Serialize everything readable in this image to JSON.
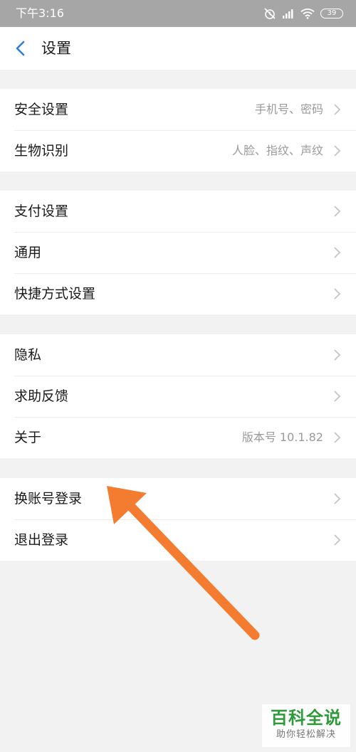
{
  "status_bar": {
    "time": "下午3:16",
    "battery": "39",
    "icons": [
      "alarm-off-icon",
      "signal-icon",
      "wifi-icon",
      "battery-icon"
    ]
  },
  "header": {
    "back_icon": "chevron-left-icon",
    "title": "设置",
    "accent_color": "#2b7fd9"
  },
  "groups": [
    {
      "items": [
        {
          "label": "安全设置",
          "value": "手机号、密码"
        },
        {
          "label": "生物识别",
          "value": "人脸、指纹、声纹"
        }
      ]
    },
    {
      "items": [
        {
          "label": "支付设置",
          "value": ""
        },
        {
          "label": "通用",
          "value": ""
        },
        {
          "label": "快捷方式设置",
          "value": ""
        }
      ]
    },
    {
      "items": [
        {
          "label": "隐私",
          "value": ""
        },
        {
          "label": "求助反馈",
          "value": ""
        },
        {
          "label": "关于",
          "value": "版本号 10.1.82"
        }
      ]
    },
    {
      "items": [
        {
          "label": "换账号登录",
          "value": ""
        },
        {
          "label": "退出登录",
          "value": ""
        }
      ]
    }
  ],
  "annotation": {
    "arrow_color": "#f47c30",
    "points_to": "换账号登录"
  },
  "watermark": {
    "title": "百科全说",
    "subtitle": "助你轻松解决",
    "color": "#2e9a3a"
  }
}
